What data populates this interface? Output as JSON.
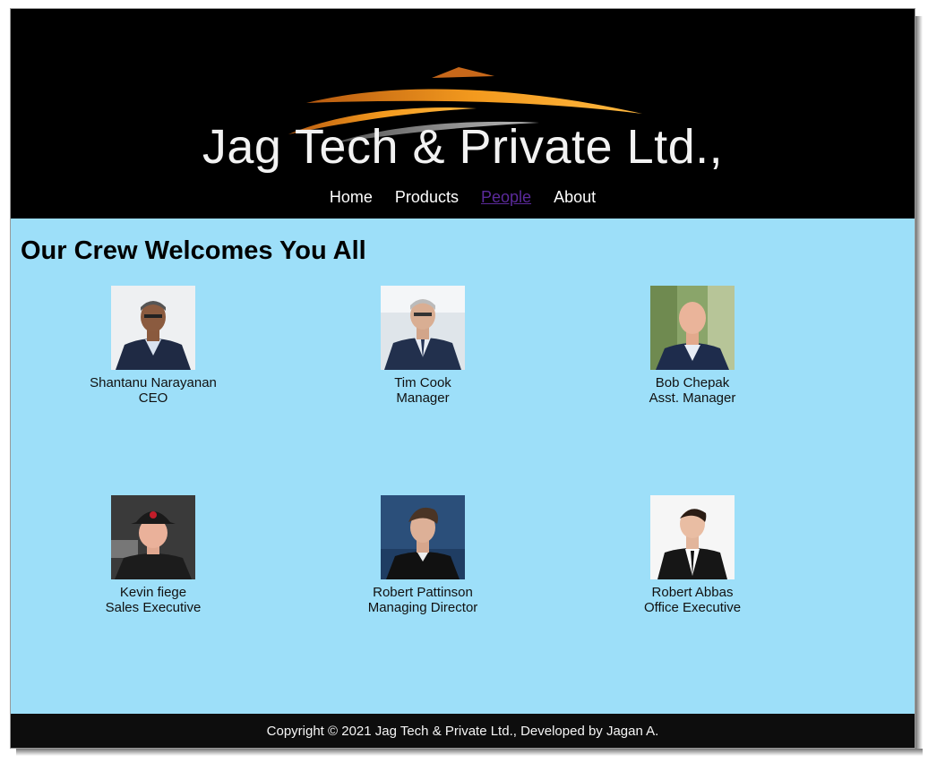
{
  "site": {
    "title": "Jag Tech & Private Ltd.,"
  },
  "nav": [
    {
      "label": "Home"
    },
    {
      "label": "Products"
    },
    {
      "label": "People",
      "active": true
    },
    {
      "label": "About"
    }
  ],
  "main": {
    "heading": "Our Crew Welcomes You All",
    "people": [
      {
        "name": "Shantanu Narayanan",
        "role": "CEO"
      },
      {
        "name": "Tim Cook",
        "role": "Manager"
      },
      {
        "name": "Bob Chepak",
        "role": "Asst. Manager"
      },
      {
        "name": "Kevin fiege",
        "role": "Sales Executive"
      },
      {
        "name": "Robert Pattinson",
        "role": "Managing Director"
      },
      {
        "name": "Robert Abbas",
        "role": "Office Executive"
      }
    ]
  },
  "footer": {
    "text": "Copyright © 2021 Jag Tech & Private Ltd., Developed by Jagan A."
  },
  "colors": {
    "header_bg": "#000000",
    "main_bg": "#9ddff9",
    "footer_bg": "#0d0d0d",
    "active_link": "#5b2a9b",
    "logo_orange": "#f39a1e"
  }
}
